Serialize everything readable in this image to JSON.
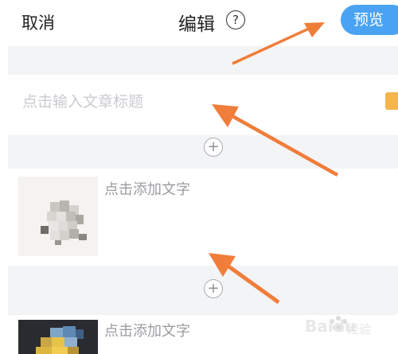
{
  "header": {
    "cancel_label": "取消",
    "title": "编辑",
    "help_glyph": "?",
    "preview_label": "预览"
  },
  "editor": {
    "title_placeholder": "点击输入文章标题",
    "add_glyph": "+",
    "blocks": [
      {
        "text_placeholder": "点击添加文字",
        "image": "pixelated-photo"
      },
      {
        "text_placeholder": "点击添加文字",
        "image": "pixelated-photo"
      }
    ]
  },
  "annotations": {
    "arrow_color": "#f07d3a",
    "arrow_count": 3
  },
  "watermark": {
    "brand": "Baidu",
    "sub": "经验"
  },
  "colors": {
    "accent": "#4aa3f2",
    "background_band": "#f3f4f6",
    "placeholder": "#c9cbd0",
    "title_icon": "#f5b54a"
  }
}
